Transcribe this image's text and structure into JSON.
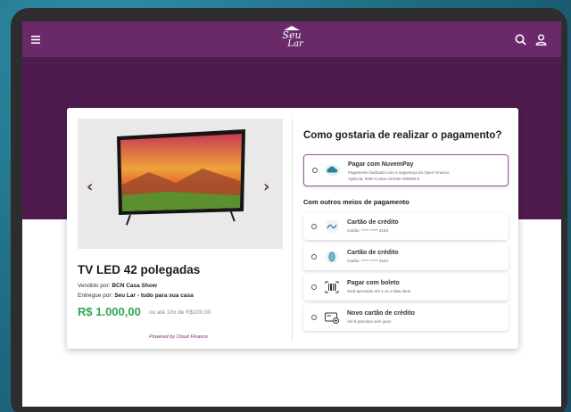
{
  "header": {
    "logo_line1": "Seu",
    "logo_line2": "Lar"
  },
  "product": {
    "title": "TV LED 42 polegadas",
    "sold_by_label": "Vendido por:",
    "sold_by": "BCN Casa Show",
    "delivered_by_label": "Entregue por:",
    "delivered_by": "Seu Lar - tudo para sua casa",
    "price": "R$ 1.000,00",
    "installments": "ou até 10x de R$100,00",
    "powered_by": "Powered by Cloud Finance"
  },
  "payment": {
    "title": "Como gostaria de realizar o pagamento?",
    "primary": {
      "label": "Pagar com NuvemPay",
      "sub1": "Pagamento facilitado com a segurança do Open Finance",
      "sub2": "Agência: 0000      Conta corrente 000000-5",
      "icon": "cloud-icon"
    },
    "others_title": "Com outros meios de pagamento",
    "others": [
      {
        "label": "Cartão de crédito",
        "sub": "Cartão: ***** ***** 3194",
        "icon": "card-wave-icon"
      },
      {
        "label": "Cartão de crédito",
        "sub": "Cartão: ***** ***** 3194",
        "icon": "card-round-icon"
      },
      {
        "label": "Pagar com boleto",
        "sub": "Será aprovado em 1 ou 2 dias úteis",
        "icon": "barcode-icon"
      },
      {
        "label": "Novo cartão de crédito",
        "sub": "Até 8 parcelas sem juros",
        "icon": "new-card-icon"
      }
    ]
  },
  "colors": {
    "brand_purple": "#6a2a6a",
    "hero_purple": "#4f1b4f",
    "price_green": "#2fa84f"
  }
}
